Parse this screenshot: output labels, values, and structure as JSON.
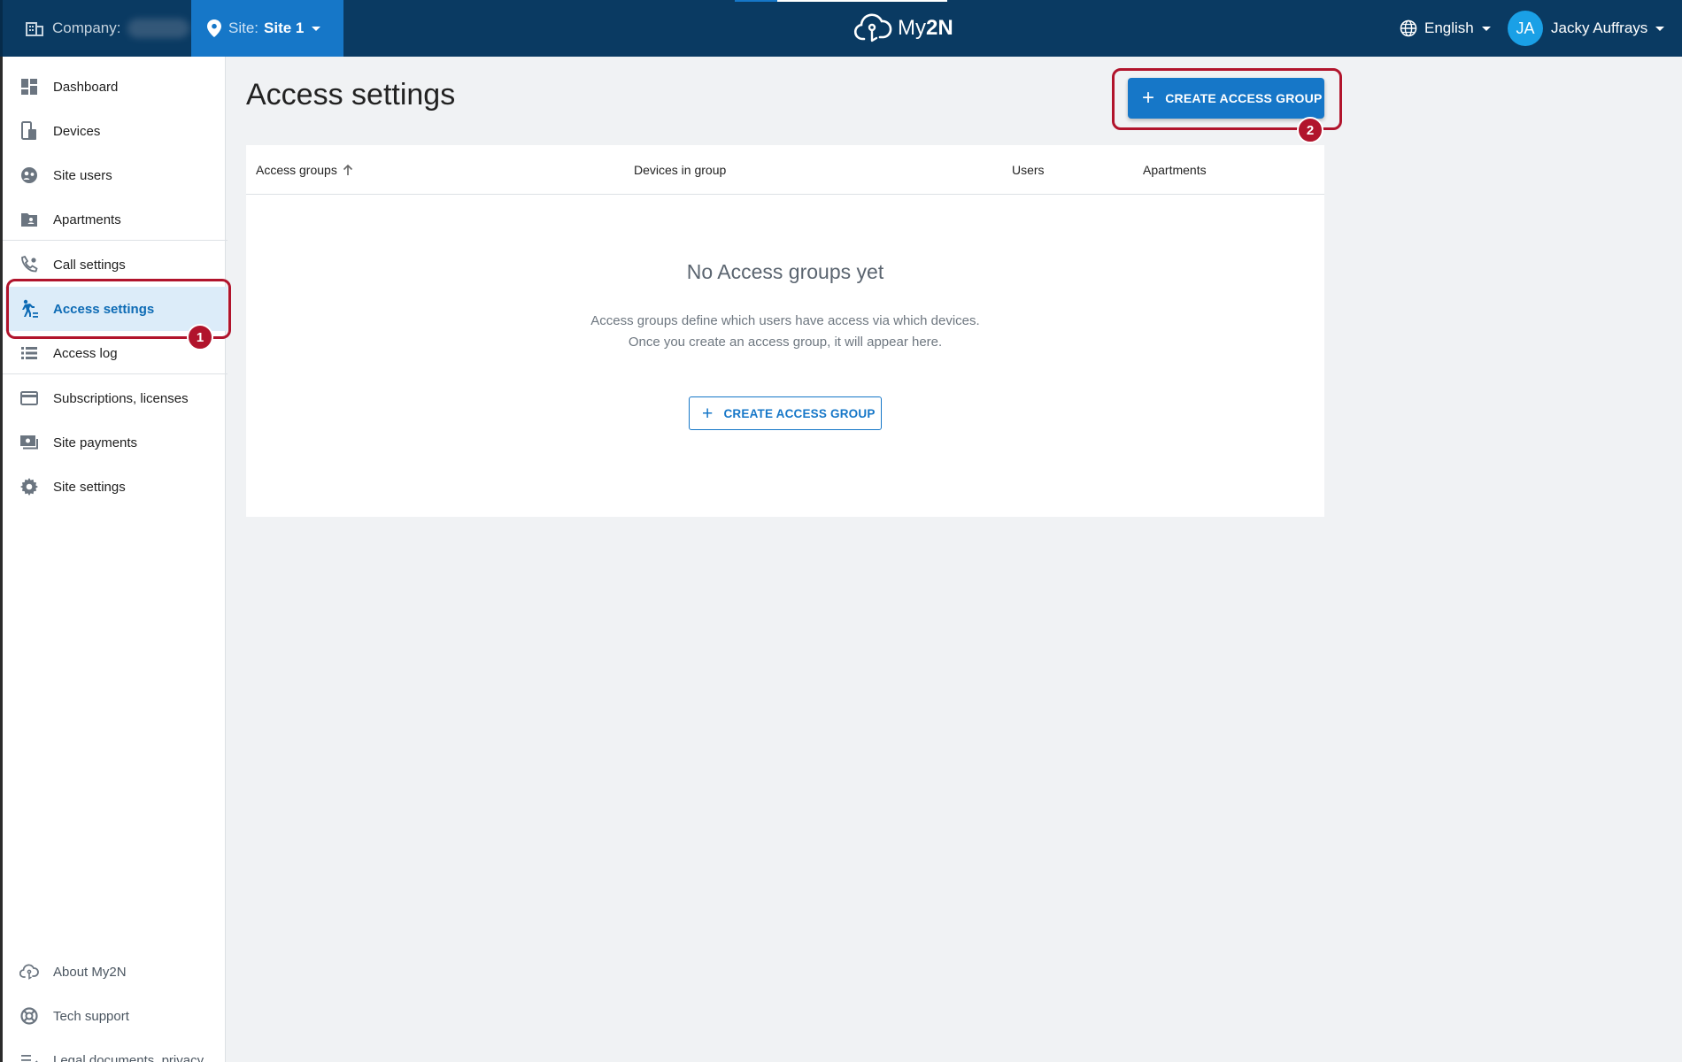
{
  "topbar": {
    "company_label": "Company:",
    "site_label": "Site:",
    "site_value": "Site 1",
    "logo_text_1": "My",
    "logo_text_2": "2N",
    "language": "English",
    "user_initials": "JA",
    "user_name": "Jacky Auffrays"
  },
  "sidebar": {
    "items": [
      {
        "label": "Dashboard",
        "icon": "dashboard-icon"
      },
      {
        "label": "Devices",
        "icon": "devices-icon"
      },
      {
        "label": "Site users",
        "icon": "users-icon"
      },
      {
        "label": "Apartments",
        "icon": "apartment-icon"
      },
      {
        "label": "Call settings",
        "icon": "phone-settings-icon"
      },
      {
        "label": "Access settings",
        "icon": "access-walk-icon",
        "active": true
      },
      {
        "label": "Access log",
        "icon": "list-icon"
      },
      {
        "label": "Subscriptions, licenses",
        "icon": "credit-card-icon"
      },
      {
        "label": "Site payments",
        "icon": "payments-icon"
      },
      {
        "label": "Site settings",
        "icon": "gear-icon"
      }
    ],
    "footer_items": [
      {
        "label": "About My2N",
        "icon": "cloud-icon"
      },
      {
        "label": "Tech support",
        "icon": "lifebuoy-icon"
      },
      {
        "label": "Legal documents, privacy",
        "icon": "checklist-icon"
      }
    ]
  },
  "main": {
    "title": "Access settings",
    "create_button": "CREATE ACCESS GROUP",
    "table": {
      "columns": [
        "Access groups",
        "Devices in group",
        "Users",
        "Apartments"
      ]
    },
    "empty": {
      "title": "No Access groups yet",
      "line1": "Access groups define which users have access via which devices.",
      "line2": "Once you create an access group, it will appear here.",
      "button": "CREATE ACCESS GROUP"
    }
  },
  "annotations": {
    "step1": "1",
    "step2": "2"
  },
  "colors": {
    "topbar": "#0a3a62",
    "accent": "#1677c8",
    "annotation": "#b1142c",
    "active_bg": "#dcecf9"
  }
}
